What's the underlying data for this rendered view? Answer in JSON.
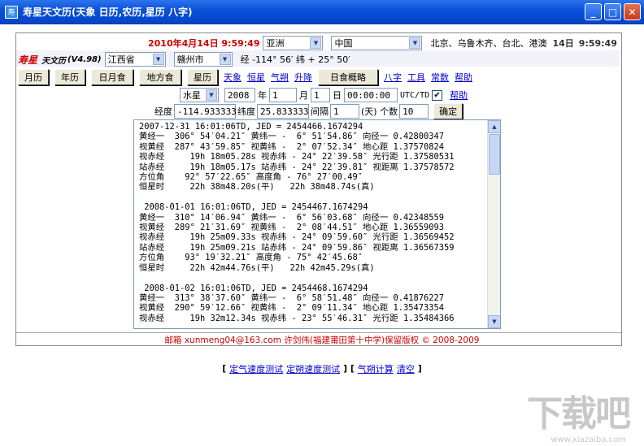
{
  "window": {
    "title": "寿星天文历(天象 日历,农历,星历 八字)"
  },
  "header": {
    "datetime": "2010年4月14日 9:59:49",
    "continent": "亚洲",
    "country": "中国",
    "cities": "北京、乌鲁木齐、台北、港澳",
    "right_day": "14日",
    "right_time": "9:59:49"
  },
  "brand": {
    "name": "寿星",
    "name2": "天文历",
    "version": "(V4.98)",
    "province": "江西省",
    "city": "赣州市",
    "coords": "经 -114° 56′ 纬 + 25° 50′"
  },
  "toolbar": {
    "buttons": [
      "月历",
      "年历",
      "日月食",
      "地方食",
      "星历"
    ],
    "links": [
      "天象",
      "恒星",
      "气朔",
      "升降"
    ],
    "eclipse_btn": "日食概略",
    "links2": [
      "八字",
      "工具",
      "常数",
      "帮助"
    ]
  },
  "params": {
    "planet": "水星",
    "year": "2008",
    "year_unit": "年",
    "month": "1",
    "month_unit": "月",
    "day": "1",
    "day_unit": "日",
    "time": "00:00:00",
    "utc_label": "UTC/TD",
    "help": "帮助",
    "lon_label": "经度",
    "lon": "-114.933333",
    "lat_label": "纬度",
    "lat": "25.833333",
    "interval_label": "间隔",
    "interval": "1",
    "interval_unit": "(天) 个数",
    "count": "10",
    "ok": "确定"
  },
  "output_lines": [
    "2007-12-31 16:01:06TD, JED = 2454466.1674294",
    "黄经一  306° 54′04.21″ 黄纬一 -  6° 51′54.86″ 向径一 0.42800347",
    "视黄经  287° 43′59.85″ 视黄纬 -  2° 07′52.34″ 地心距 1.37570824",
    "视赤经     19h 18m05.28s 视赤纬 - 24° 22′39.58″ 光行距 1.37580531",
    "站赤经     19h 18m05.17s 站赤纬 - 24° 22′39.81″ 视距离 1.37578572",
    "方位角    92° 57′22.65″ 高度角 - 76° 27′00.49″",
    "恒星时     22h 38m48.20s(平)   22h 38m48.74s(真)",
    "",
    " 2008-01-01 16:01:06TD, JED = 2454467.1674294",
    "黄经一  310° 14′06.94″ 黄纬一 -  6° 56′03.68″ 向径一 0.42348559",
    "视黄经  289° 21′31.69″ 视黄纬 -  2° 08′44.51″ 地心距 1.36559093",
    "视赤经     19h 25m09.33s 视赤纬 - 24° 09′59.60″ 光行距 1.36569452",
    "站赤经     19h 25m09.21s 站赤纬 - 24° 09′59.86″ 视距离 1.36567359",
    "方位角    93° 19′32.21″ 高度角 - 75° 42′45.68″",
    "恒星时     22h 42m44.76s(平)   22h 42m45.29s(真)",
    "",
    " 2008-01-02 16:01:06TD, JED = 2454468.1674294",
    "黄经一  313° 38′37.60″ 黄纬一 -  6° 58′51.48″ 向径一 0.41876227",
    "视黄经  290° 59′12.66″ 视黄纬 -  2° 09′11.34″ 地心距 1.35473354",
    "视赤经     19h 32m12.34s 视赤纬 - 23° 55′46.31″ 光行距 1.35484366"
  ],
  "footer": "邮箱 xunmeng04@163.com 许剑伟(福建莆田第十中学)保留版权 © 2008-2009",
  "bottom_links": [
    "定气速度测试",
    "定朔速度测试",
    "气朔计算",
    "清空"
  ],
  "watermark": {
    "main": "下载吧",
    "sub": "www.xiazaiba.com"
  }
}
